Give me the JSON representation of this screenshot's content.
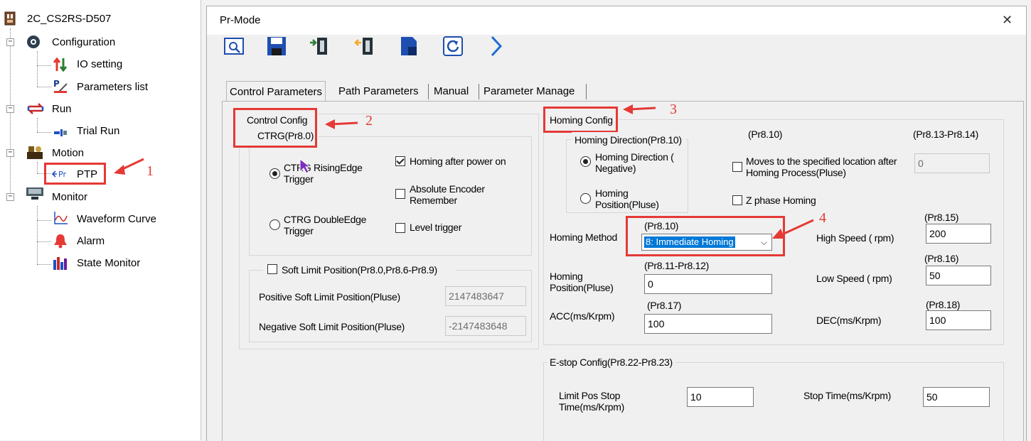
{
  "tree": {
    "root": "2C_CS2RS-D507",
    "items": [
      {
        "label": "Configuration",
        "icon": "gear-icon"
      },
      {
        "label": "IO setting",
        "icon": "io-arrows-icon"
      },
      {
        "label": "Parameters list",
        "icon": "parameters-icon"
      },
      {
        "label": "Run",
        "icon": "run-cycle-icon"
      },
      {
        "label": "Trial Run",
        "icon": "trial-run-icon"
      },
      {
        "label": "Motion",
        "icon": "motion-icon"
      },
      {
        "label": "PTP",
        "icon": "ptp-icon"
      },
      {
        "label": "Monitor",
        "icon": "monitor-icon"
      },
      {
        "label": "Waveform Curve",
        "icon": "waveform-icon"
      },
      {
        "label": "Alarm",
        "icon": "alarm-bell-icon"
      },
      {
        "label": "State Monitor",
        "icon": "state-monitor-icon"
      }
    ]
  },
  "dialog": {
    "title": "Pr-Mode",
    "close": "✕",
    "tabs": [
      "Control Parameters",
      "Path Parameters",
      "Manual",
      "Parameter Manage"
    ]
  },
  "control": {
    "group_title": "Control Config",
    "ctrg_title": "CTRG(Pr8.0)",
    "rising_l1": "CTRG RisingEdge",
    "rising_l2": "Trigger",
    "double_l1": "CTRG DoubleEdge",
    "double_l2": "Trigger",
    "homing_after": "Homing after power on",
    "abs_l1": "Absolute Encoder",
    "abs_l2": "Remember",
    "level": "Level trigger",
    "soft_limit": "Soft Limit Position(Pr8.0,Pr8.6-Pr8.9)",
    "pos_label": "Positive Soft Limit Position(Pluse)",
    "pos_value": "2147483647",
    "neg_label": "Negative Soft Limit Position(Pluse)",
    "neg_value": "-2147483648"
  },
  "homing": {
    "group_title": "Homing Config",
    "dir_title": "Homing Direction(Pr8.10)",
    "neg_l1": "Homing Direction (",
    "neg_l2": "Negative)",
    "pos_l1": "Homing",
    "pos_l2": "Position(Pluse)",
    "pr810_top": "(Pr8.10)",
    "pr813": "(Pr8.13-Pr8.14)",
    "moves_l1": "Moves to the specified location after",
    "moves_l2": "Homing Process(Pluse)",
    "moves_value": "0",
    "zphase": "Z phase Homing",
    "method_label": "Homing Method",
    "method_pr": "(Pr8.10)",
    "method_value": "8: Immediate Homing",
    "high_pr": "(Pr8.15)",
    "high_label": "High Speed ( rpm)",
    "high_value": "200",
    "pos_pr": "(Pr8.11-Pr8.12)",
    "pos_value": "0",
    "low_pr": "(Pr8.16)",
    "low_label": "Low Speed ( rpm)",
    "low_value": "50",
    "acc_pr": "(Pr8.17)",
    "acc_label": "ACC(ms/Krpm)",
    "acc_value": "100",
    "dec_pr": "(Pr8.18)",
    "dec_label": "DEC(ms/Krpm)",
    "dec_value": "100"
  },
  "estop": {
    "title": "E-stop Config(Pr8.22-Pr8.23)",
    "limit_l1": "Limit Pos Stop",
    "limit_l2": "Time(ms/Krpm)",
    "limit_value": "10",
    "stop_label": "Stop Time(ms/Krpm)",
    "stop_value": "50"
  },
  "annotations": [
    "1",
    "2",
    "3",
    "4"
  ],
  "colors": {
    "annotation": "#e53935",
    "selection": "#0078d7",
    "arrow_icon": "#1e6bd6"
  }
}
